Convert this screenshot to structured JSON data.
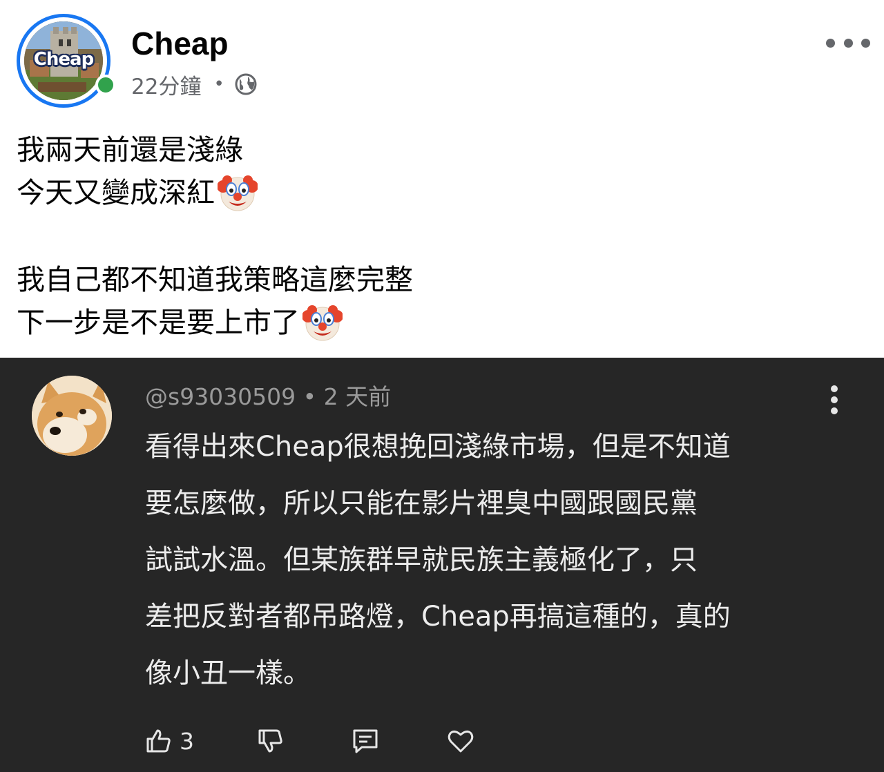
{
  "post": {
    "page_name": "Cheap",
    "avatar_text": "Cheap",
    "time": "22分鐘",
    "separator": "•",
    "audience_icon": "globe-icon",
    "lines": [
      "我兩天前還是淺綠",
      "今天又變成深紅",
      "我自己都不知道我策略這麼完整",
      "下一步是不是要上市了"
    ],
    "emoji": "clown-face"
  },
  "comment": {
    "username": "@s93030509",
    "separator": "•",
    "time": "2 天前",
    "lines": [
      "看得出來Cheap很想挽回淺綠市場，但是不知道",
      "要怎麼做，所以只能在影片裡臭中國跟國民黨",
      "試試水溫。但某族群早就民族主義極化了，只",
      "差把反對者都吊路燈，Cheap再搞這種的，真的",
      "像小丑一樣。"
    ],
    "like_count": "3"
  },
  "colors": {
    "brand_blue": "#1877f2",
    "online_green": "#31a24c",
    "comment_bg": "#262626"
  }
}
